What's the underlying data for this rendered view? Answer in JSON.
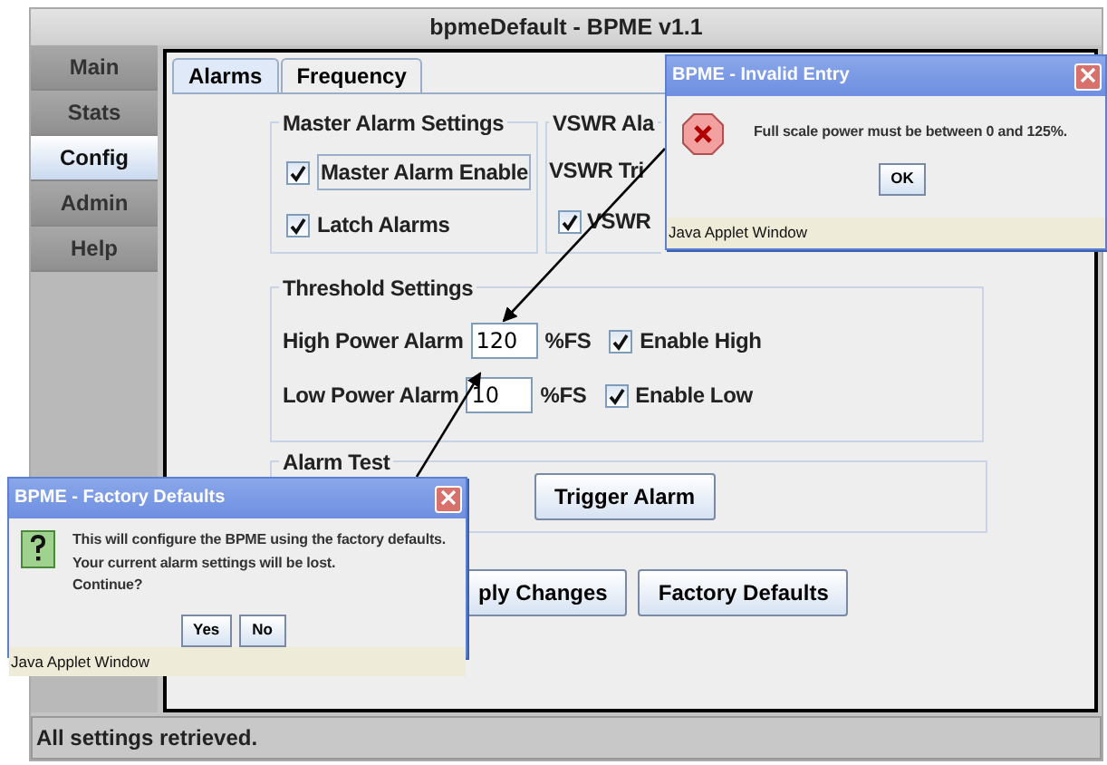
{
  "window": {
    "title": "bpmeDefault - BPME v1.1"
  },
  "sidebar": {
    "items": [
      {
        "label": "Main",
        "selected": false
      },
      {
        "label": "Stats",
        "selected": false
      },
      {
        "label": "Config",
        "selected": true
      },
      {
        "label": "Admin",
        "selected": false
      },
      {
        "label": "Help",
        "selected": false
      }
    ]
  },
  "tabs": [
    {
      "label": "Alarms",
      "selected": true
    },
    {
      "label": "Frequency",
      "selected": false
    }
  ],
  "master_alarm_settings": {
    "title": "Master Alarm Settings",
    "options": [
      {
        "label": "Master Alarm Enable",
        "checked": true
      },
      {
        "label": "Latch Alarms",
        "checked": true
      }
    ]
  },
  "vswr_group": {
    "title": "VSWR Ala",
    "label": "VSWR Tri",
    "option": {
      "label": "VSWR",
      "checked": true
    }
  },
  "threshold_settings": {
    "title": "Threshold Settings",
    "rows": [
      {
        "label": "High Power Alarm",
        "value": "120",
        "unit": "%FS",
        "enable": {
          "label": "Enable High",
          "checked": true
        }
      },
      {
        "label": "Low Power Alarm",
        "value": "10",
        "unit": "%FS",
        "enable": {
          "label": "Enable Low",
          "checked": true
        }
      }
    ]
  },
  "alarm_test": {
    "title": "Alarm Test",
    "button": "Trigger Alarm"
  },
  "buttons": [
    "ply Changes",
    "Factory Defaults"
  ],
  "status_bar": "All settings retrieved.",
  "dialogs": [
    {
      "kind": "error",
      "title": "BPME - Invalid Entry",
      "message": [
        "Full scale power must be between 0 and 125%."
      ],
      "buttons": [
        "OK"
      ],
      "footer": "Java Applet Window"
    },
    {
      "kind": "question",
      "title": "BPME - Factory Defaults",
      "message": [
        "This will configure the BPME using the factory defaults.",
        "Your current alarm settings will be lost.",
        "Continue?"
      ],
      "buttons": [
        "Yes",
        "No"
      ],
      "footer": "Java Applet Window"
    }
  ]
}
